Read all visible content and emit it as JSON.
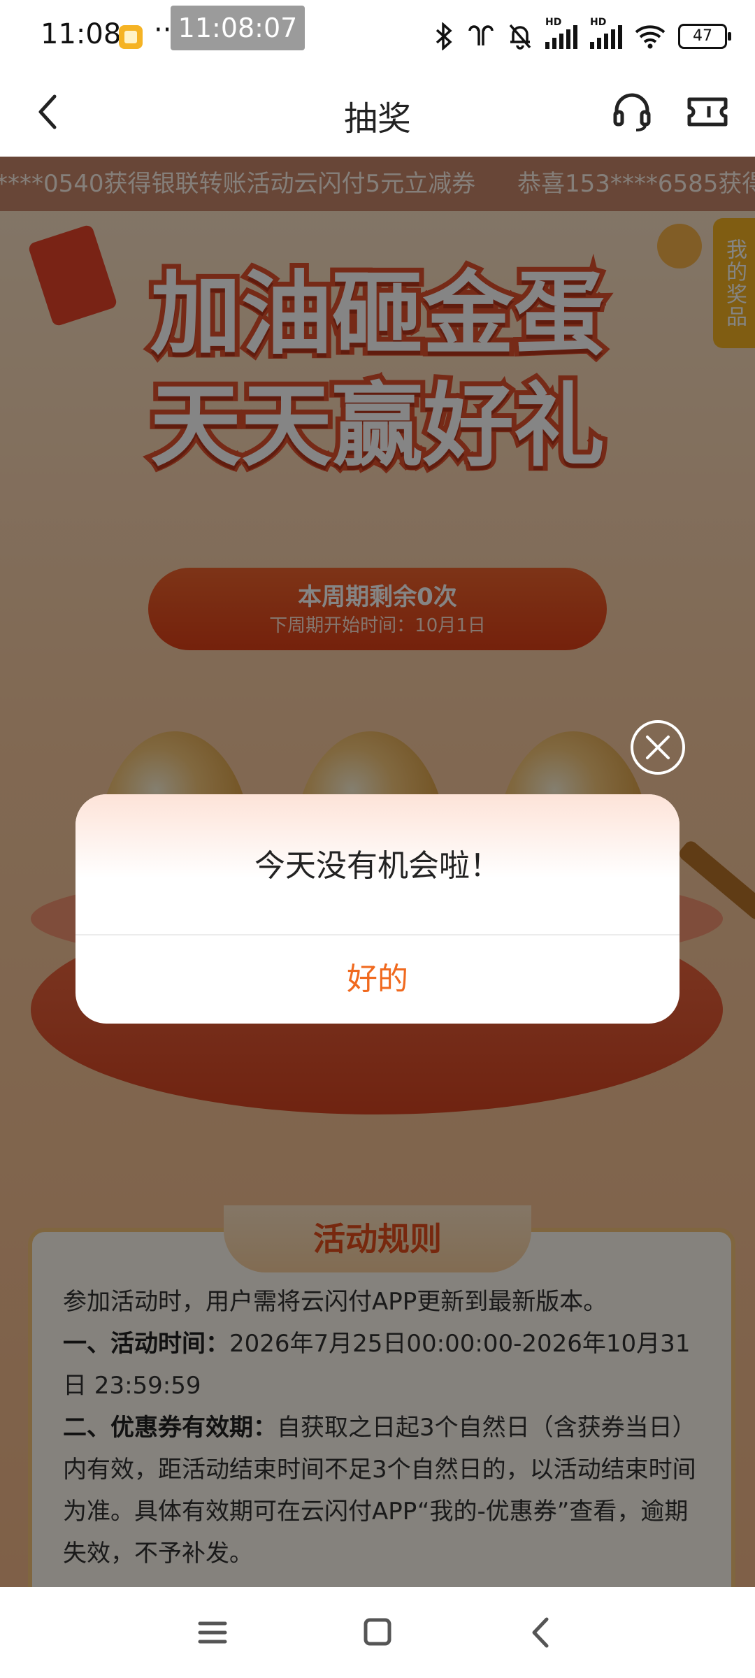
{
  "status_bar": {
    "time": "11:08",
    "dots": "···",
    "clock_overlay": "11:08:07",
    "hd1": "HD",
    "hd2": "HD",
    "battery": "47"
  },
  "header": {
    "title": "抽奖"
  },
  "ticker": {
    "item1": "****0540获得银联转账活动云闪付5元立减券",
    "item2": "恭喜153****6585获得"
  },
  "banner": {
    "line1": "加油砸金蛋",
    "line2": "天天赢好礼"
  },
  "prize_tab": "我的奖品",
  "remaining": {
    "count_text": "本周期剩余0次",
    "next_period": "下周期开始时间：10月1日"
  },
  "rules": {
    "title": "活动规则",
    "intro": "参加活动时，用户需将云闪付APP更新到最新版本。",
    "time_label": "一、活动时间：",
    "time_value": "2026年7月25日00:00:00-2026年10月31日 23:59:59",
    "validity_label": "二、优惠券有效期：",
    "validity_value": "自获取之日起3个自然日（含获券当日）内有效，距活动结束时间不足3个自然日的，以活动结束时间为准。具体有效期可在云闪付APP“我的-优惠券”查看，逾期失效，不予补发。"
  },
  "dialog": {
    "message": "今天没有机会啦！",
    "ok_label": "好的"
  },
  "colors": {
    "accent": "#f0691e",
    "banner_red": "#e2512d",
    "prize_tab": "#f5b324"
  }
}
